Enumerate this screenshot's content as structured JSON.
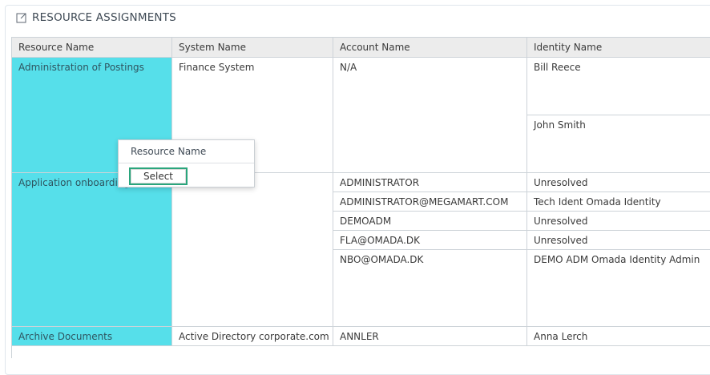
{
  "panel": {
    "title": "RESOURCE ASSIGNMENTS",
    "icon": "external-link-icon"
  },
  "columns": [
    "Resource Name",
    "System Name",
    "Account Name",
    "Identity Name"
  ],
  "rows": {
    "r1": {
      "resource": "Administration of Postings",
      "system": "Finance System",
      "account": "N/A",
      "identities": [
        "Bill Reece",
        "John Smith"
      ]
    },
    "r2": {
      "resource": "Application onboarding",
      "system": "",
      "accounts": [
        "ADMINISTRATOR",
        "ADMINISTRATOR@MEGAMART.COM",
        "DEMOADM",
        "FLA@OMADA.DK",
        "NBO@OMADA.DK"
      ],
      "identities": [
        "Unresolved",
        "Tech Ident Omada Identity",
        "Unresolved",
        "Unresolved",
        "DEMO ADM Omada Identity Admin"
      ]
    },
    "r3": {
      "resource": "Archive Documents",
      "system": "Active Directory corporate.com",
      "account": "ANNLER",
      "identity": "Anna Lerch"
    }
  },
  "context_menu": {
    "header": "Resource Name",
    "select_label": "Select"
  },
  "colors": {
    "resource_cell_bg": "#56dfea",
    "header_bg": "#ececec",
    "select_border": "#2aa57c"
  }
}
